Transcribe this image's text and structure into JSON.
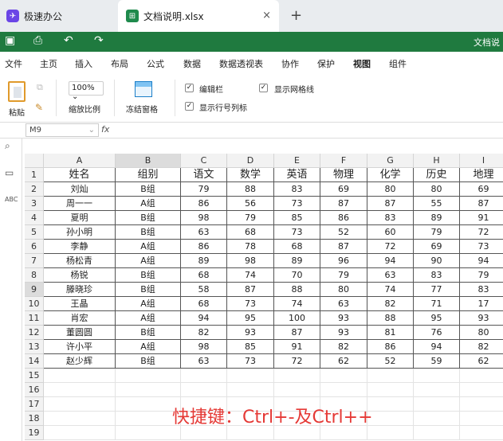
{
  "tabs": [
    {
      "label": "极速办公",
      "icon": "app-logo"
    },
    {
      "label": "文档说明.xlsx",
      "icon": "xlsx-icon",
      "close": "×"
    }
  ],
  "add_tab": "+",
  "toolbar": {
    "doc_title": "文档说",
    "icons": [
      "save-icon",
      "print-icon",
      "undo-icon",
      "redo-icon"
    ]
  },
  "menu": [
    "文件",
    "主页",
    "插入",
    "布局",
    "公式",
    "数据",
    "数据透视表",
    "协作",
    "保护",
    "视图",
    "组件"
  ],
  "active_menu": "视图",
  "ribbon": {
    "paste": "粘贴",
    "zoom_value": "100%",
    "zoom_label": "缩放比例",
    "freeze": "冻结窗格",
    "formula_bar": "编辑栏",
    "gridlines": "显示网格线",
    "headers": "显示行号列标"
  },
  "formula": {
    "cell_ref": "M9",
    "fx": "fx"
  },
  "col_headers": [
    "A",
    "B",
    "C",
    "D",
    "E",
    "F",
    "G",
    "H",
    "I"
  ],
  "row_numbers": [
    "1",
    "2",
    "3",
    "4",
    "5",
    "6",
    "7",
    "8",
    "9",
    "10",
    "11",
    "12",
    "13",
    "14",
    "15",
    "16",
    "17",
    "18",
    "19"
  ],
  "selected_row": "9",
  "table": {
    "header": [
      "姓名",
      "组别",
      "语文",
      "数学",
      "英语",
      "物理",
      "化学",
      "历史",
      "地理"
    ],
    "rows": [
      [
        "刘灿",
        "B组",
        "79",
        "88",
        "83",
        "69",
        "80",
        "80",
        "69"
      ],
      [
        "周一一",
        "A组",
        "86",
        "56",
        "73",
        "87",
        "87",
        "55",
        "87"
      ],
      [
        "夏明",
        "B组",
        "98",
        "79",
        "85",
        "86",
        "83",
        "89",
        "91"
      ],
      [
        "孙小明",
        "B组",
        "63",
        "68",
        "73",
        "52",
        "60",
        "79",
        "72"
      ],
      [
        "李静",
        "A组",
        "86",
        "78",
        "68",
        "87",
        "72",
        "69",
        "73"
      ],
      [
        "杨松青",
        "A组",
        "89",
        "98",
        "89",
        "96",
        "94",
        "90",
        "94"
      ],
      [
        "杨锐",
        "B组",
        "68",
        "74",
        "70",
        "79",
        "63",
        "83",
        "79"
      ],
      [
        "滕晓珍",
        "B组",
        "58",
        "87",
        "88",
        "80",
        "74",
        "77",
        "83"
      ],
      [
        "王晶",
        "A组",
        "68",
        "73",
        "74",
        "63",
        "82",
        "71",
        "17"
      ],
      [
        "肖宏",
        "A组",
        "94",
        "95",
        "100",
        "93",
        "88",
        "95",
        "93"
      ],
      [
        "董圆圆",
        "B组",
        "82",
        "93",
        "87",
        "93",
        "81",
        "76",
        "80"
      ],
      [
        "许小平",
        "A组",
        "98",
        "85",
        "91",
        "82",
        "86",
        "94",
        "82"
      ],
      [
        "赵少辉",
        "B组",
        "63",
        "73",
        "72",
        "62",
        "52",
        "59",
        "62"
      ]
    ]
  },
  "shortcut_text": "快捷键：Ctrl+-及Ctrl++",
  "colors": {
    "accent": "#1f7a3f",
    "shortcut": "#e53935"
  }
}
